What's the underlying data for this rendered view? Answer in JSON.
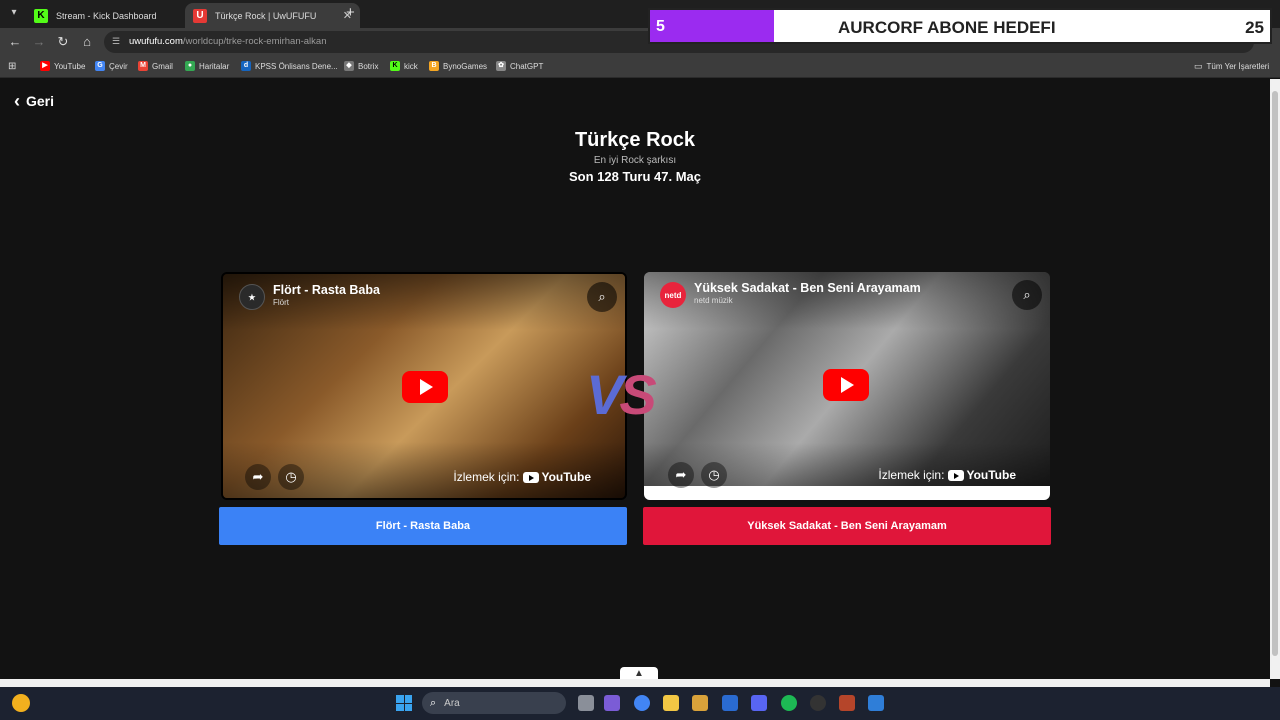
{
  "browser": {
    "tabs": [
      {
        "label": "Stream - Kick Dashboard",
        "icon": "kick-icon",
        "active": false
      },
      {
        "label": "Türkçe Rock | UwUFUFU",
        "icon": "uwufufu-icon",
        "active": true
      }
    ],
    "url_host": "uwufufu.com",
    "url_path": "/worldcup/trke-rock-emirhan-alkan",
    "bookmarks": [
      {
        "label": "YouTube",
        "icon": "youtube-icon",
        "color": "#ff0000"
      },
      {
        "label": "Çevir",
        "icon": "translate-icon",
        "color": "#4285f4"
      },
      {
        "label": "Gmail",
        "icon": "gmail-icon",
        "color": "#ea4335"
      },
      {
        "label": "Haritalar",
        "icon": "maps-icon",
        "color": "#34a853"
      },
      {
        "label": "KPSS Önlisans Dene...",
        "icon": "dc-icon",
        "color": "#1565c0"
      },
      {
        "label": "Botrix",
        "icon": "botrix-icon",
        "color": "#777777"
      },
      {
        "label": "kick",
        "icon": "kick-icon",
        "color": "#53fc18"
      },
      {
        "label": "BynoGames",
        "icon": "bynogames-icon",
        "color": "#f5a623"
      },
      {
        "label": "ChatGPT",
        "icon": "chatgpt-icon",
        "color": "#888888"
      }
    ],
    "all_bookmarks": "Tüm Yer İşaretleri"
  },
  "overlay": {
    "current": "5",
    "title": "AURCORF ABONE HEDEFI",
    "target": "25",
    "progress": 0.2
  },
  "page": {
    "back_label": "Geri",
    "title": "Türkçe Rock",
    "subtitle": "En iyi Rock şarkısı",
    "round": "Son 128 Turu 47. Maç",
    "vs_label": "VS",
    "left": {
      "video_title": "Flört - Rasta Baba",
      "channel": "Flört",
      "watch_text": "İzlemek için:",
      "choice_label": "Flört - Rasta Baba"
    },
    "right": {
      "video_title": "Yüksek Sadakat - Ben Seni Arayamam",
      "channel": "netd müzik",
      "channel_logo": "netd",
      "watch_text": "İzlemek için:",
      "choice_label": "Yüksek Sadakat - Ben Seni Arayamam"
    },
    "youtube_label": "YouTube"
  },
  "taskbar": {
    "search_placeholder": "Ara"
  },
  "colors": {
    "left_choice": "#3b82f6",
    "right_choice": "#e0163a",
    "goal_fill": "#9b2bf0"
  }
}
